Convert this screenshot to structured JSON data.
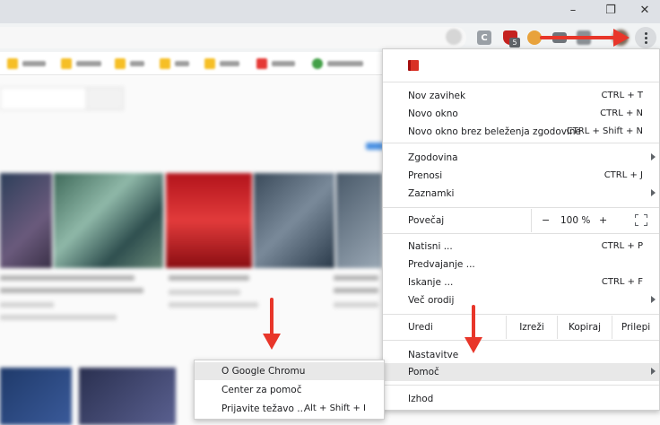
{
  "window": {
    "minimize_glyph": "–",
    "restore_glyph": "❐",
    "close_glyph": "✕"
  },
  "toolbar": {
    "extension_c_label": "C",
    "extension_badge": "5",
    "menu_icon": "kebab-menu-icon"
  },
  "menu": {
    "items": [
      {
        "label": "Nov zavihek",
        "shortcut": "CTRL + T"
      },
      {
        "label": "Novo okno",
        "shortcut": "CTRL + N"
      },
      {
        "label": "Novo okno brez beleženja zgodovine",
        "shortcut": "CTRL + Shift + N"
      },
      {
        "label": "Zgodovina",
        "shortcut": ""
      },
      {
        "label": "Prenosi",
        "shortcut": "CTRL + J"
      },
      {
        "label": "Zaznamki",
        "shortcut": ""
      },
      {
        "label": "Natisni ...",
        "shortcut": "CTRL + P"
      },
      {
        "label": "Predvajanje ...",
        "shortcut": ""
      },
      {
        "label": "Iskanje ...",
        "shortcut": "CTRL + F"
      },
      {
        "label": "Več orodij",
        "shortcut": ""
      },
      {
        "label": "Nastavitve",
        "shortcut": ""
      },
      {
        "label": "Pomoč",
        "shortcut": ""
      },
      {
        "label": "Izhod",
        "shortcut": ""
      }
    ],
    "zoom": {
      "label": "Povečaj",
      "minus": "−",
      "value": "100 %",
      "plus": "+"
    },
    "edit": {
      "label": "Uredi",
      "cut": "Izreži",
      "copy": "Kopiraj",
      "paste": "Prilepi"
    }
  },
  "help_submenu": {
    "items": [
      {
        "label": "O Google Chromu",
        "shortcut": ""
      },
      {
        "label": "Center za pomoč",
        "shortcut": ""
      },
      {
        "label": "Prijavite težavo ...",
        "shortcut": "Alt + Shift + I"
      }
    ]
  },
  "colors": {
    "annotation_arrow": "#e8362a",
    "menu_highlight": "#e8e8e8"
  }
}
